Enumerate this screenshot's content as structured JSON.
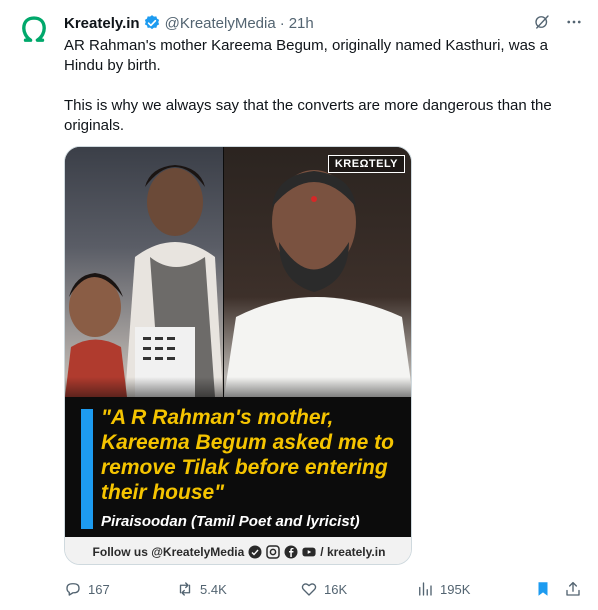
{
  "post": {
    "author_name": "Kreately.in",
    "handle": "@KreatelyMedia",
    "separator": "·",
    "time": "21h",
    "text_p1": "AR Rahman's mother Kareema Begum, originally named Kasthuri, was a Hindu by birth.",
    "text_p2": "This is why we always say that the converts are more dangerous than the originals."
  },
  "media": {
    "brand_logo": "KREΩTELY",
    "quote": "\"A R Rahman's mother, Kareema Begum asked me to remove Tilak before entering their house\"",
    "attribution": "Piraisoodan (Tamil Poet and lyricist)",
    "follow_text": "Follow us @KreatelyMedia",
    "site_text": "/ kreately.in"
  },
  "actions": {
    "replies": "167",
    "reposts": "5.4K",
    "likes": "16K",
    "views": "195K"
  },
  "colors": {
    "brand_green": "#00a86b",
    "verified_blue": "#1d9bf0",
    "quote_yellow": "#f5c400",
    "bookmark_blue": "#1d9bf0",
    "muted_text": "#536471"
  }
}
